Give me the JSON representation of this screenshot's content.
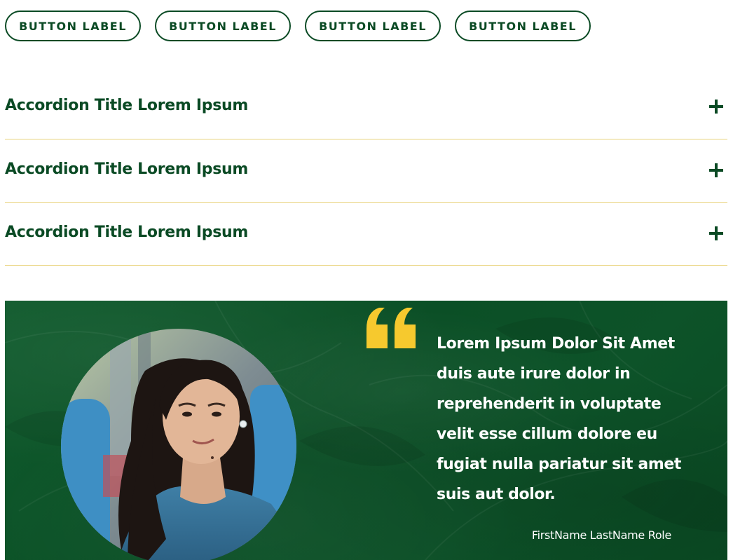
{
  "buttons": [
    {
      "label": "BUTTON LABEL"
    },
    {
      "label": "BUTTON LABEL"
    },
    {
      "label": "BUTTON LABEL"
    },
    {
      "label": "BUTTON LABEL"
    }
  ],
  "accordion": {
    "items": [
      {
        "title": "Accordion Title Lorem Ipsum",
        "icon": "plus-icon"
      },
      {
        "title": "Accordion Title Lorem Ipsum",
        "icon": "plus-icon"
      },
      {
        "title": "Accordion Title Lorem Ipsum",
        "icon": "plus-icon"
      }
    ]
  },
  "testimonial": {
    "quote": "Lorem Ipsum Dolor Sit Amet duis aute irure dolor in reprehenderit in voluptate velit esse cillum dolore eu fugiat nulla pariatur sit amet suis aut dolor.",
    "attribution": "FirstName LastName Role",
    "quote_icon": "quote-mark-icon",
    "portrait": "person-portrait"
  },
  "colors": {
    "brand_green": "#0a4a24",
    "accent_yellow": "#f6c92e",
    "divider": "#e8d27a"
  }
}
